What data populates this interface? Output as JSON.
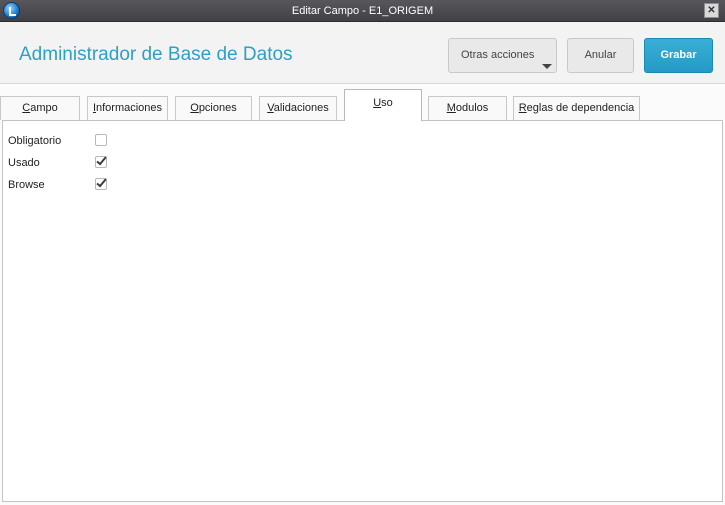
{
  "window": {
    "title": "Editar Campo - E1_ORIGEM"
  },
  "header": {
    "app_title": "Administrador de Base de Datos",
    "more_actions_label": "Otras acciones",
    "cancel_label": "Anular",
    "save_label": "Grabar"
  },
  "tabs": [
    {
      "key": "C",
      "rest": "ampo",
      "active": false
    },
    {
      "key": "I",
      "rest": "nformaciones",
      "active": false
    },
    {
      "key": "O",
      "rest": "pciones",
      "active": false
    },
    {
      "key": "V",
      "rest": "alidaciones",
      "active": false
    },
    {
      "key": "U",
      "rest": "so",
      "active": true
    },
    {
      "key": "M",
      "rest": "odulos",
      "active": false
    },
    {
      "key": "R",
      "rest": "eglas de dependencia",
      "active": false
    }
  ],
  "form": {
    "fields": [
      {
        "label": "Obligatorio",
        "checked": false
      },
      {
        "label": "Usado",
        "checked": true
      },
      {
        "label": "Browse",
        "checked": true
      }
    ]
  },
  "colors": {
    "accent": "#2e9fc6",
    "save_button": "#239bc6",
    "titlebar": "#4a4a4e"
  }
}
